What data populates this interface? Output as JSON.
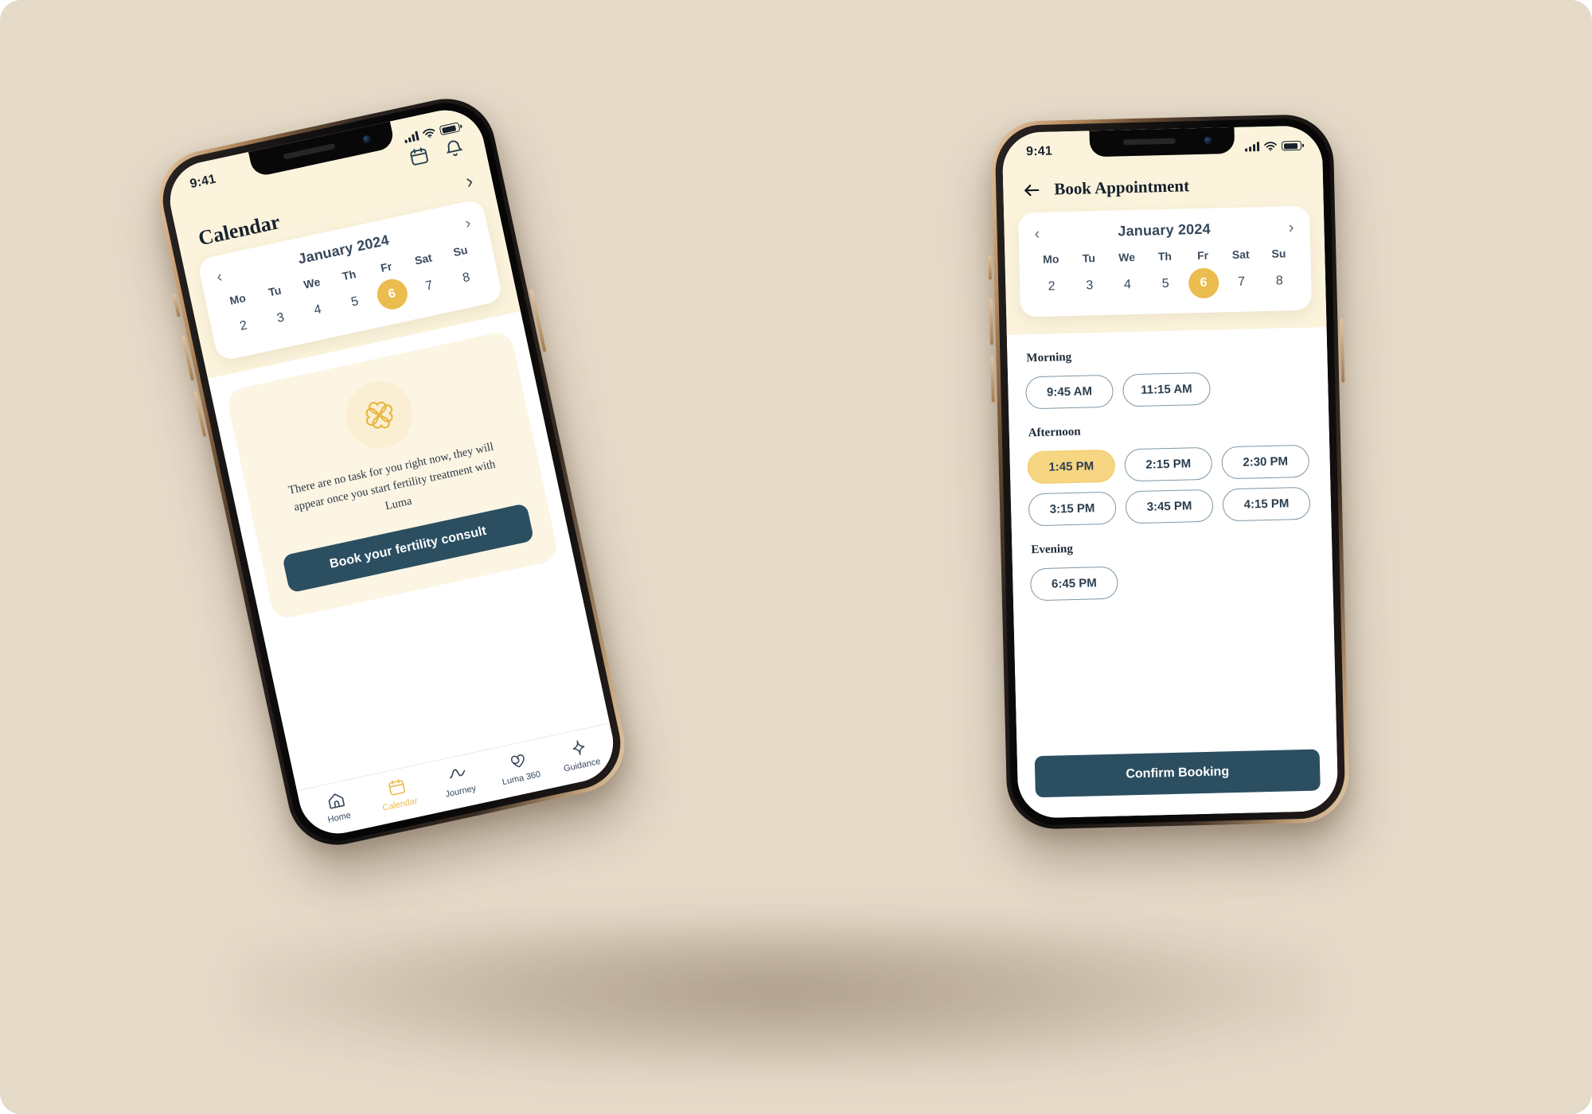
{
  "theme": {
    "page_background": "#E5D9C8",
    "screen_cream": "#FBF3DC",
    "accent_gold": "#EBBC4E",
    "accent_gold_soft": "#F6D583",
    "ink_teal": "#2B4F61",
    "text_dark": "#17222e"
  },
  "left_phone": {
    "status_bar": {
      "time": "9:41",
      "signal_icon": "cellular-bars-icon",
      "wifi_icon": "wifi-icon",
      "battery_icon": "battery-icon"
    },
    "header": {
      "calendar_icon": "calendar-icon",
      "bell_icon": "bell-icon",
      "title": "Calendar",
      "forward_chevron": "chevron-right-icon"
    },
    "calendar_card": {
      "prev_icon": "chevron-left-icon",
      "month": "January 2024",
      "next_icon": "chevron-right-icon",
      "weekdays": [
        "Mo",
        "Tu",
        "We",
        "Th",
        "Fr",
        "Sat",
        "Su"
      ],
      "dates": [
        {
          "label": "2",
          "selected": false
        },
        {
          "label": "3",
          "selected": false
        },
        {
          "label": "4",
          "selected": false
        },
        {
          "label": "5",
          "selected": false
        },
        {
          "label": "6",
          "selected": true
        },
        {
          "label": "7",
          "selected": false
        },
        {
          "label": "8",
          "selected": false
        }
      ]
    },
    "empty_state": {
      "illustration_icon": "four-leaf-clover-icon",
      "message": "There are no task for you right now, they will appear once you start fertility treatment with Luma",
      "cta_label": "Book your fertility consult"
    },
    "tab_bar": {
      "items": [
        {
          "label": "Home",
          "icon": "home-icon",
          "active": false
        },
        {
          "label": "Calendar",
          "icon": "calendar-icon",
          "active": true
        },
        {
          "label": "Journey",
          "icon": "journey-wave-icon",
          "active": false
        },
        {
          "label": "Luma 360",
          "icon": "heart-loop-icon",
          "active": false
        },
        {
          "label": "Guidance",
          "icon": "sparkle-icon",
          "active": false
        }
      ]
    }
  },
  "right_phone": {
    "status_bar": {
      "time": "9:41",
      "signal_icon": "cellular-bars-icon",
      "wifi_icon": "wifi-icon",
      "battery_icon": "battery-icon"
    },
    "header": {
      "back_icon": "arrow-left-icon",
      "title": "Book Appointment"
    },
    "calendar_card": {
      "prev_icon": "chevron-left-icon",
      "month": "January 2024",
      "next_icon": "chevron-right-icon",
      "weekdays": [
        "Mo",
        "Tu",
        "We",
        "Th",
        "Fr",
        "Sat",
        "Su"
      ],
      "dates": [
        {
          "label": "2",
          "selected": false
        },
        {
          "label": "3",
          "selected": false
        },
        {
          "label": "4",
          "selected": false
        },
        {
          "label": "5",
          "selected": false
        },
        {
          "label": "6",
          "selected": true
        },
        {
          "label": "7",
          "selected": false
        },
        {
          "label": "8",
          "selected": false
        }
      ]
    },
    "sections": [
      {
        "label": "Morning",
        "slots": [
          {
            "time": "9:45 AM",
            "selected": false
          },
          {
            "time": "11:15 AM",
            "selected": false
          }
        ]
      },
      {
        "label": "Afternoon",
        "slots": [
          {
            "time": "1:45 PM",
            "selected": true
          },
          {
            "time": "2:15 PM",
            "selected": false
          },
          {
            "time": "2:30 PM",
            "selected": false
          },
          {
            "time": "3:15 PM",
            "selected": false
          },
          {
            "time": "3:45 PM",
            "selected": false
          },
          {
            "time": "4:15 PM",
            "selected": false
          }
        ]
      },
      {
        "label": "Evening",
        "slots": [
          {
            "time": "6:45 PM",
            "selected": false
          }
        ]
      }
    ],
    "confirm_label": "Confirm Booking"
  }
}
